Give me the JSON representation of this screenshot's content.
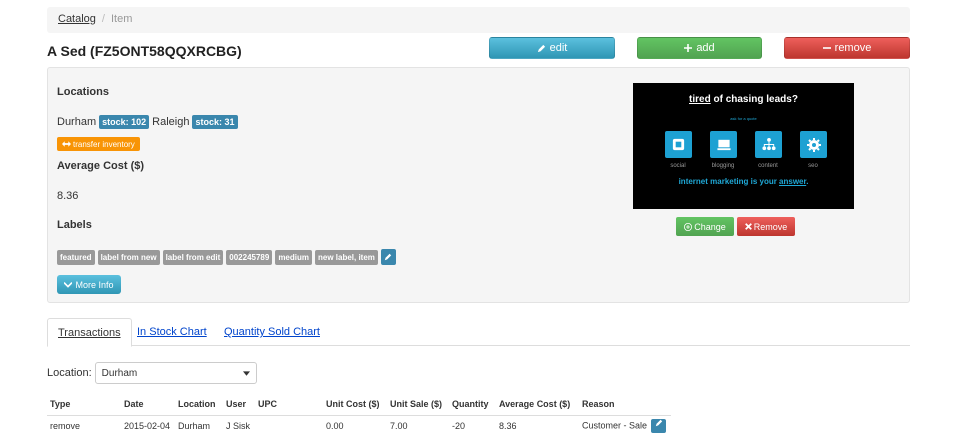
{
  "breadcrumb": {
    "catalog": "Catalog",
    "separator": "/",
    "current": "Item"
  },
  "title": "A Sed (FZ5ONT58QQXRCBG)",
  "actions": {
    "edit": "edit",
    "add": "add",
    "remove": "remove"
  },
  "panel": {
    "locations_heading": "Locations",
    "locations": [
      {
        "name": "Durham",
        "stock": "stock: 102"
      },
      {
        "name": "Raleigh",
        "stock": "stock: 31"
      }
    ],
    "transfer_label": "transfer inventory",
    "avg_cost_heading": "Average Cost ($)",
    "avg_cost_value": "8.36",
    "labels_heading": "Labels",
    "labels": [
      "featured",
      "label from new",
      "label from edit",
      "002245789",
      "medium",
      "new label, item"
    ],
    "more_info": "More Info"
  },
  "ad": {
    "title_underlined": "tired",
    "title_rest": " of chasing leads?",
    "subtitle": "ask for a quote",
    "icons": [
      {
        "label": "social",
        "icon": "social-icon"
      },
      {
        "label": "blogging",
        "icon": "blogging-icon"
      },
      {
        "label": "content",
        "icon": "content-icon"
      },
      {
        "label": "seo",
        "icon": "seo-gear-icon"
      }
    ],
    "tagline_start": "internet marketing is your ",
    "tagline_underlined": "answer",
    "tagline_end": "."
  },
  "image_actions": {
    "change": "Change",
    "remove": "Remove"
  },
  "tabs": [
    "Transactions",
    "In Stock Chart",
    "Quantity Sold Chart"
  ],
  "filter": {
    "label": "Location:",
    "selected": "Durham"
  },
  "table": {
    "headers": [
      "Type",
      "Date",
      "Location",
      "User",
      "UPC",
      "Unit Cost ($)",
      "Unit Sale ($)",
      "Quantity",
      "Average Cost ($)",
      "Reason"
    ],
    "rows": [
      [
        "remove",
        "2015-02-04",
        "Durham",
        "J Sisk",
        "",
        "0.00",
        "7.00",
        "-20",
        "8.36",
        "Customer - Sale"
      ]
    ]
  },
  "colors": {
    "info": "#2f96b4",
    "success": "#51a351",
    "danger": "#bd362f",
    "warning": "#f89406",
    "badge": "#3a87ad"
  }
}
